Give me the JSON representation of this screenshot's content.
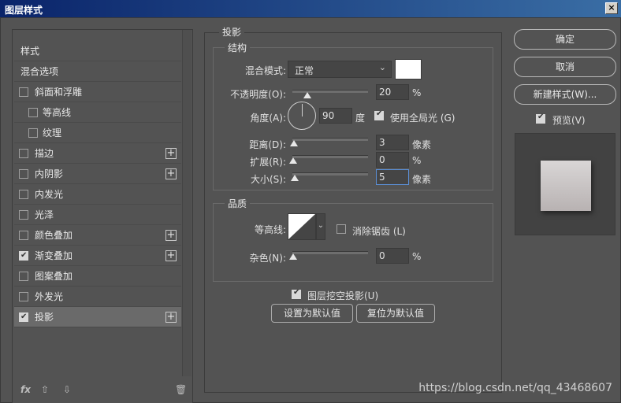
{
  "window": {
    "title": "图层样式",
    "close_label": "×"
  },
  "left": {
    "items": [
      {
        "label": "样式",
        "checkbox": false,
        "checked": false,
        "plus": false,
        "indent": "none"
      },
      {
        "label": "混合选项",
        "checkbox": false,
        "checked": false,
        "plus": false,
        "indent": "none"
      },
      {
        "label": "斜面和浮雕",
        "checkbox": true,
        "checked": false,
        "plus": false,
        "indent": "normal"
      },
      {
        "label": "等高线",
        "checkbox": true,
        "checked": false,
        "plus": false,
        "indent": "sub"
      },
      {
        "label": "纹理",
        "checkbox": true,
        "checked": false,
        "plus": false,
        "indent": "sub"
      },
      {
        "label": "描边",
        "checkbox": true,
        "checked": false,
        "plus": true,
        "indent": "normal"
      },
      {
        "label": "内阴影",
        "checkbox": true,
        "checked": false,
        "plus": true,
        "indent": "normal"
      },
      {
        "label": "内发光",
        "checkbox": true,
        "checked": false,
        "plus": false,
        "indent": "normal"
      },
      {
        "label": "光泽",
        "checkbox": true,
        "checked": false,
        "plus": false,
        "indent": "normal"
      },
      {
        "label": "颜色叠加",
        "checkbox": true,
        "checked": false,
        "plus": true,
        "indent": "normal"
      },
      {
        "label": "渐变叠加",
        "checkbox": true,
        "checked": true,
        "plus": true,
        "indent": "normal"
      },
      {
        "label": "图案叠加",
        "checkbox": true,
        "checked": false,
        "plus": false,
        "indent": "normal"
      },
      {
        "label": "外发光",
        "checkbox": true,
        "checked": false,
        "plus": false,
        "indent": "normal"
      },
      {
        "label": "投影",
        "checkbox": true,
        "checked": true,
        "plus": true,
        "indent": "normal",
        "selected": true
      }
    ],
    "footer": {
      "fx": "fx",
      "up": "⇧",
      "down": "⇩",
      "trash": "🗑"
    }
  },
  "panel": {
    "title": "投影",
    "structure": {
      "title": "结构",
      "blend_mode_label": "混合模式:",
      "blend_mode_value": "正常",
      "opacity_label": "不透明度(O):",
      "opacity_value": "20",
      "opacity_unit": "%",
      "opacity_fraction": 0.2,
      "angle_label": "角度(A):",
      "angle_value": "90",
      "angle_unit": "度",
      "global_light_label": "使用全局光 (G)",
      "global_light_checked": true,
      "distance_label": "距离(D):",
      "distance_value": "3",
      "distance_unit": "像素",
      "spread_label": "扩展(R):",
      "spread_value": "0",
      "spread_unit": "%",
      "size_label": "大小(S):",
      "size_value": "5",
      "size_unit": "像素"
    },
    "quality": {
      "title": "品质",
      "contour_label": "等高线:",
      "antialias_label": "消除锯齿 (L)",
      "antialias_checked": false,
      "noise_label": "杂色(N):",
      "noise_value": "0",
      "noise_unit": "%"
    },
    "knockout_label": "图层挖空投影(U)",
    "knockout_checked": true,
    "set_default_label": "设置为默认值",
    "reset_default_label": "复位为默认值"
  },
  "right": {
    "ok_label": "确定",
    "cancel_label": "取消",
    "new_style_label": "新建样式(W)...",
    "preview_label": "预览(V)",
    "preview_checked": true
  },
  "watermark": "https://blog.csdn.net/qq_43468607"
}
